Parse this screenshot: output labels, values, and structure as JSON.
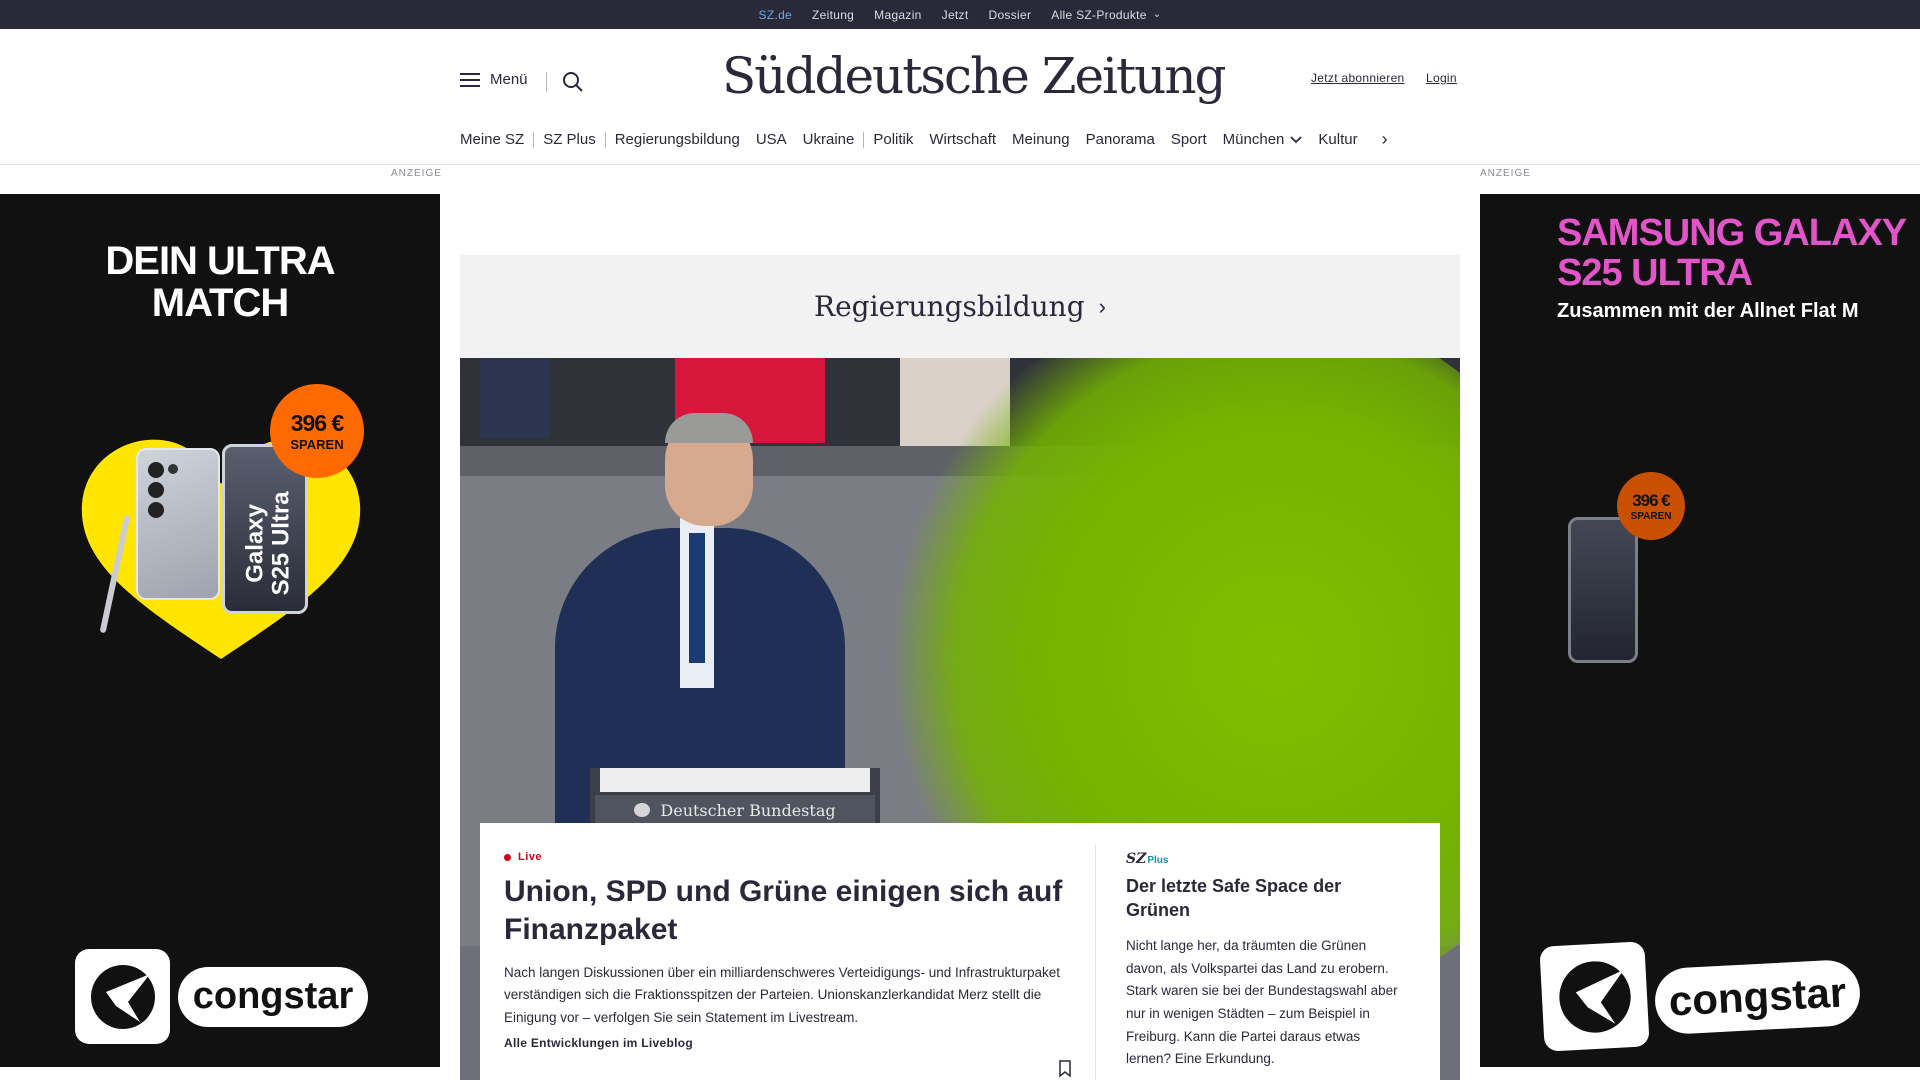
{
  "topbar": {
    "links": [
      "SZ.de",
      "Zeitung",
      "Magazin",
      "Jetzt",
      "Dossier",
      "Alle SZ-Produkte"
    ]
  },
  "header": {
    "menu_label": "Menü",
    "logo_text": "Süddeutsche Zeitung",
    "subscribe_label": "Jetzt abonnieren",
    "login_label": "Login"
  },
  "nav": {
    "items": [
      "Meine SZ",
      "SZ Plus",
      "Regierungsbildung",
      "USA",
      "Ukraine",
      "Politik",
      "Wirtschaft",
      "Meinung",
      "Panorama",
      "Sport",
      "München",
      "Kultur"
    ]
  },
  "ads": {
    "label": "ANZEIGE",
    "left": {
      "headline_1": "DEIN ULTRA",
      "headline_2": "MATCH",
      "badge_amount": "396 €",
      "badge_text": "SPAREN",
      "phone_text_1": "Galaxy",
      "phone_text_2": "S25 Ultra",
      "brand": "congstar"
    },
    "right": {
      "headline_1": "SAMSUNG GALAXY",
      "headline_2": "S25 ULTRA",
      "subline": "Zusammen mit der Allnet Flat M",
      "badge_amount": "396 €",
      "badge_text": "SPAREN",
      "brand": "congstar"
    }
  },
  "banner": {
    "title": "Regierungsbildung",
    "chevron": "›"
  },
  "hero": {
    "lectern_sign": "Deutscher Bundestag"
  },
  "lead_story": {
    "live_label": "Live",
    "headline": "Union, SPD und Grüne einigen sich auf Finanzpaket",
    "teaser": "Nach langen Diskussionen über ein milliardenschweres Verteidigungs- und Infrastrukturpaket verständigen sich die Fraktionsspitzen der Parteien. Unionskanzlerkandidat Merz stellt die Einigung vor – verfolgen Sie sein Statement im Livestream.",
    "more_link": "Alle Entwicklungen im Liveblog"
  },
  "side_story": {
    "brand_sz": "SZ",
    "brand_plus": "Plus",
    "headline": "Der letzte Safe Space der Grünen",
    "teaser": "Nicht lange her, da träumten die Grünen davon, als Volkspartei das Land zu erobern. Stark waren sie bei der Bundestagswahl aber nur in wenigen Städten – zum Beispiel in Freiburg. Kann die Partei daraus etwas lernen? Eine Erkundung."
  },
  "colors": {
    "topbar_bg": "#29293a",
    "active_link": "#6da9dc",
    "live_red": "#d0021b",
    "ad_bg": "#111111",
    "ad_yellow": "#ffe500",
    "ad_orange": "#ff6a00",
    "ad_pink": "#e255c8"
  }
}
